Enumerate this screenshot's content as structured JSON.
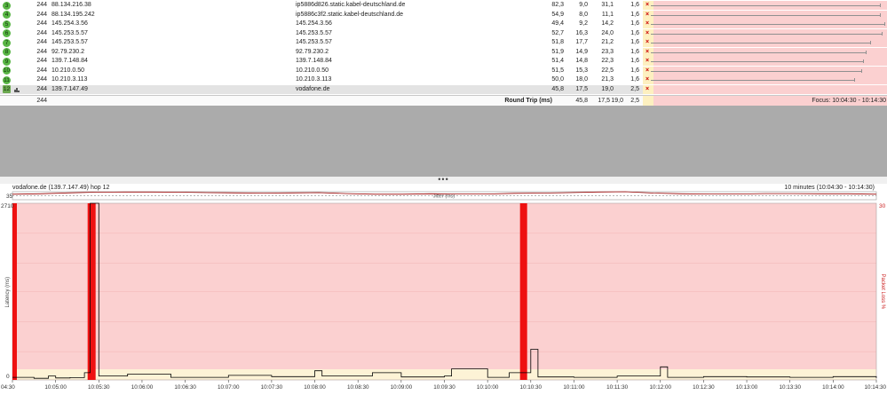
{
  "trace": {
    "rows": [
      {
        "hop": "3",
        "count": "244",
        "ip": "88.134.216.38",
        "name": "ip5886d826.static.kabel-deutschland.de",
        "avg": "82,3",
        "min": "9,0",
        "cur": "31,1",
        "pl": "1,6",
        "range_end": 0.98
      },
      {
        "hop": "4",
        "count": "244",
        "ip": "88.134.195.242",
        "name": "ip5886c3f2.static.kabel-deutschland.de",
        "avg": "54,9",
        "min": "8,0",
        "cur": "11,1",
        "pl": "1,6",
        "range_end": 0.98
      },
      {
        "hop": "5",
        "count": "244",
        "ip": "145.254.3.56",
        "name": "145.254.3.56",
        "avg": "49,4",
        "min": "9,2",
        "cur": "14,2",
        "pl": "1,6",
        "range_end": 1.0
      },
      {
        "hop": "6",
        "count": "244",
        "ip": "145.253.5.57",
        "name": "145.253.5.57",
        "avg": "52,7",
        "min": "16,3",
        "cur": "24,0",
        "pl": "1,6",
        "range_end": 0.99
      },
      {
        "hop": "7",
        "count": "244",
        "ip": "145.253.5.57",
        "name": "145.253.5.57",
        "avg": "51,8",
        "min": "17,7",
        "cur": "21,2",
        "pl": "1,6",
        "range_end": 0.94
      },
      {
        "hop": "8",
        "count": "244",
        "ip": "92.79.230.2",
        "name": "92.79.230.2",
        "avg": "51,9",
        "min": "14,9",
        "cur": "23,3",
        "pl": "1,6",
        "range_end": 0.92
      },
      {
        "hop": "9",
        "count": "244",
        "ip": "139.7.148.84",
        "name": "139.7.148.84",
        "avg": "51,4",
        "min": "14,8",
        "cur": "22,3",
        "pl": "1,6",
        "range_end": 0.91
      },
      {
        "hop": "10",
        "count": "244",
        "ip": "10.210.0.50",
        "name": "10.210.0.50",
        "avg": "51,5",
        "min": "15,3",
        "cur": "22,5",
        "pl": "1,6",
        "range_end": 0.9
      },
      {
        "hop": "11",
        "count": "244",
        "ip": "10.210.3.113",
        "name": "10.210.3.113",
        "avg": "50,0",
        "min": "18,0",
        "cur": "21,3",
        "pl": "1,6",
        "range_end": 0.87
      },
      {
        "hop": "12",
        "count": "244",
        "ip": "139.7.147.49",
        "name": "vodafone.de",
        "avg": "45,8",
        "min": "17,5",
        "cur": "19,0",
        "pl": "2,5",
        "range_end": 0.0,
        "selected": true
      }
    ],
    "summary": {
      "count": "244",
      "label": "Round Trip (ms)",
      "avg": "45,8",
      "min": "17,5",
      "cur": "19,0",
      "pl": "2,5",
      "focus": "Focus: 10:04:30 - 10:14:30"
    }
  },
  "splitter": {
    "grip": "•••"
  },
  "chart": {
    "title": "vodafone.de (139.7.147.49) hop 12",
    "range": "10 minutes (10:04:30 - 10:14:30)",
    "jitter_label": "Jitter (ms)",
    "jitter_max": "35",
    "y_left_max": "2710",
    "y_left_min": "0",
    "y_right_max": "30",
    "y_left_label": "Latency (ms)",
    "y_right_label": "Packet Loss %",
    "colors": {
      "loss_bg": "#fbd0d0",
      "good_band": "#fdf3d6",
      "loss_bar": "#ee1111",
      "latency_line": "#000000",
      "jitter_line": "#990000"
    }
  },
  "chart_data": {
    "type": "line",
    "title": "vodafone.de (139.7.147.49) hop 12",
    "xlabel": "",
    "ylabel": "Latency (ms)",
    "y2label": "Packet Loss %",
    "ylim": [
      0,
      2710
    ],
    "y2lim": [
      0,
      30
    ],
    "x_ticks": [
      "04:30",
      "10:05:00",
      "10:05:30",
      "10:06:00",
      "10:06:30",
      "10:07:00",
      "10:07:30",
      "10:08:00",
      "10:08:30",
      "10:09:00",
      "10:09:30",
      "10:10:00",
      "10:10:30",
      "10:11:00",
      "10:11:30",
      "10:12:00",
      "10:12:30",
      "10:13:00",
      "10:13:30",
      "10:14:00",
      "10:14:30"
    ],
    "latency_series": {
      "name": "Latency (ms)",
      "x": [
        "10:04:30",
        "10:04:45",
        "10:04:55",
        "10:05:00",
        "10:05:10",
        "10:05:20",
        "10:05:24",
        "10:05:26",
        "10:05:30",
        "10:05:50",
        "10:06:20",
        "10:07:00",
        "10:07:30",
        "10:08:00",
        "10:08:05",
        "10:08:40",
        "10:09:00",
        "10:09:30",
        "10:09:35",
        "10:10:00",
        "10:10:15",
        "10:10:30",
        "10:10:35",
        "10:11:00",
        "10:11:30",
        "10:12:00",
        "10:12:05",
        "10:12:30",
        "10:13:00",
        "10:13:30",
        "10:14:00",
        "10:14:30"
      ],
      "values": [
        40,
        25,
        60,
        30,
        35,
        110,
        2710,
        2710,
        60,
        90,
        40,
        70,
        50,
        140,
        60,
        110,
        45,
        60,
        170,
        40,
        110,
        470,
        45,
        40,
        60,
        200,
        40,
        50,
        45,
        40,
        50,
        30
      ]
    },
    "loss_bars": {
      "name": "Packet Loss %",
      "x": [
        "10:04:30",
        "10:05:25",
        "10:10:25"
      ],
      "values": [
        30,
        30,
        30
      ]
    },
    "jitter_series": {
      "name": "Jitter (ms)",
      "values": [
        24,
        26,
        30,
        33,
        34,
        34,
        33,
        31,
        30,
        29,
        30,
        31,
        27,
        24,
        24,
        26,
        25,
        25,
        28,
        29,
        31,
        34,
        35,
        29,
        26,
        25,
        25,
        27,
        27,
        26,
        26,
        24
      ]
    }
  }
}
